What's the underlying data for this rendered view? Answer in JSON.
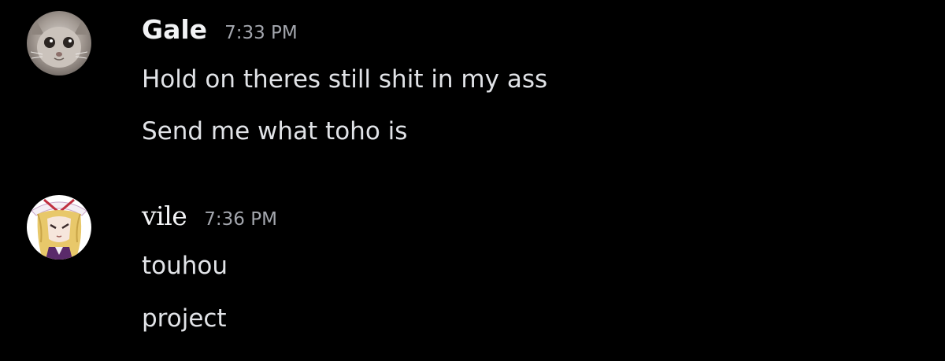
{
  "messages": [
    {
      "author": "Gale",
      "timestamp": "7:33 PM",
      "avatar_icon": "cat-avatar-icon",
      "lines": [
        "Hold on theres still shit in my ass",
        "Send me what toho is"
      ]
    },
    {
      "author": "vile",
      "timestamp": "7:36 PM",
      "avatar_icon": "anime-girl-avatar-icon",
      "lines": [
        "touhou",
        "project"
      ]
    }
  ],
  "colors": {
    "background": "#000000",
    "username": "#f2f3f5",
    "timestamp": "#a3a6ad",
    "message_text": "#e1e3e7"
  }
}
